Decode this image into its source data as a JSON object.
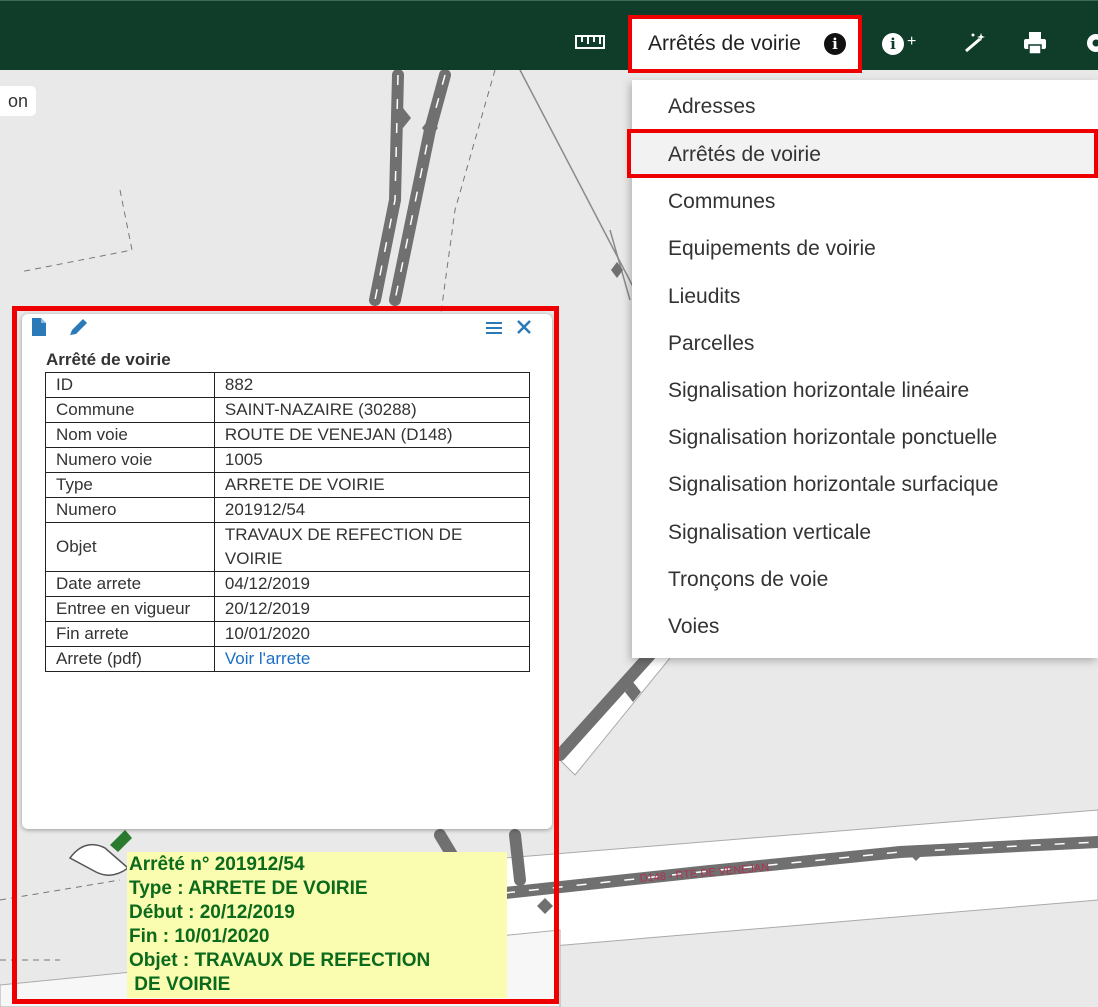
{
  "toolbar": {
    "active_layer_label": "Arrêtés de voirie",
    "icons": [
      "ruler-icon",
      "info-icon",
      "info-plus-icon",
      "magic-wand-icon",
      "print-icon",
      "gear-icon"
    ]
  },
  "left_chip": {
    "text": "on"
  },
  "layer_menu": {
    "items": [
      "Adresses",
      "Arrêtés de voirie",
      "Communes",
      "Equipements de voirie",
      "Lieudits",
      "Parcelles",
      "Signalisation horizontale linéaire",
      "Signalisation horizontale ponctuelle",
      "Signalisation horizontale surfacique",
      "Signalisation verticale",
      "Tronçons de voie",
      "Voies"
    ],
    "selected": "Arrêtés de voirie"
  },
  "popup": {
    "title": "Arrêté de voirie",
    "rows": [
      {
        "key": "ID",
        "value": "882"
      },
      {
        "key": "Commune",
        "value": "SAINT-NAZAIRE (30288)"
      },
      {
        "key": "Nom voie",
        "value": "ROUTE DE VENEJAN (D148)"
      },
      {
        "key": "Numero voie",
        "value": "1005"
      },
      {
        "key": "Type",
        "value": "ARRETE DE VOIRIE"
      },
      {
        "key": "Numero",
        "value": "201912/54"
      },
      {
        "key": "Objet",
        "value": "TRAVAUX DE REFECTION DE VOIRIE"
      },
      {
        "key": "Date arrete",
        "value": "04/12/2019"
      },
      {
        "key": "Entree en vigueur",
        "value": "20/12/2019"
      },
      {
        "key": "Fin arrete",
        "value": "10/01/2020"
      },
      {
        "key": "Arrete (pdf)",
        "value": "Voir l'arrete"
      }
    ]
  },
  "map_label": {
    "lines": [
      "Arrêté n° 201912/54",
      "Type : ARRETE DE VOIRIE",
      "Début : 20/12/2019",
      "Fin : 10/01/2020",
      "Objet : TRAVAUX DE REFECTION",
      " DE VOIRIE"
    ]
  },
  "road_label": "D148 - RTE DE VENEJAN",
  "colors": {
    "toolbar": "#0f3d2a",
    "highlight": "#e00000",
    "label_bg": "#fafcb0",
    "label_text": "#0b6a1c",
    "link": "#1a6fc4"
  }
}
